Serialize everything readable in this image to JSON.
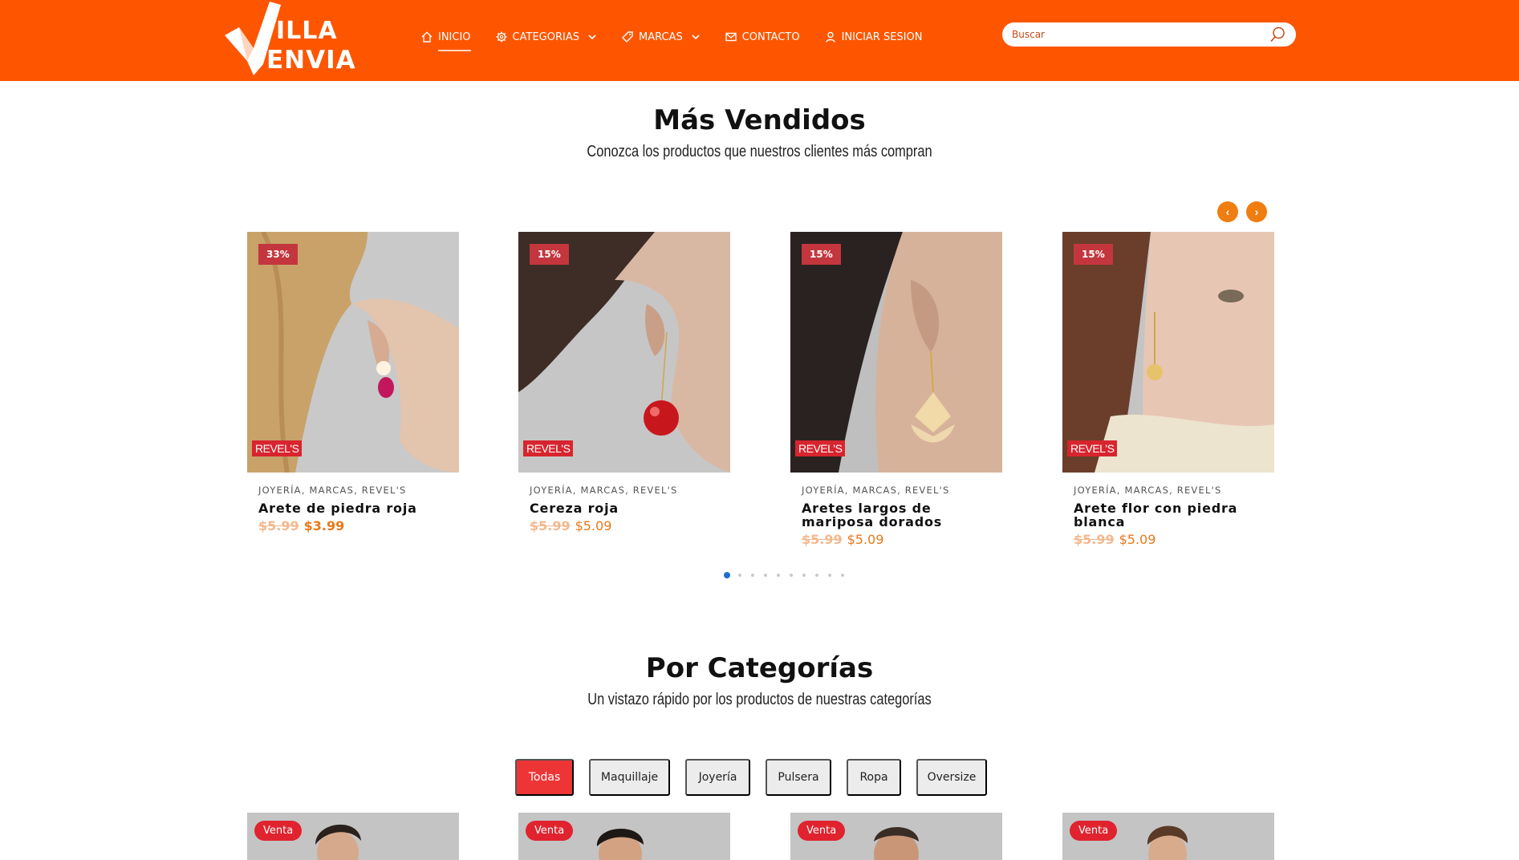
{
  "brand": {
    "line1": "ILLA",
    "line2": "ENVIA",
    "accent": "#fe5600"
  },
  "nav": [
    {
      "label": "INICIO",
      "icon": "home-icon",
      "active": true
    },
    {
      "label": "CATEGORIAS",
      "icon": "gear-icon",
      "dropdown": true
    },
    {
      "label": "MARCAS",
      "icon": "tag-icon",
      "dropdown": true
    },
    {
      "label": "CONTACTO",
      "icon": "mail-icon"
    },
    {
      "label": "INICIAR SESION",
      "icon": "user-icon"
    }
  ],
  "search": {
    "placeholder": "Buscar",
    "value": ""
  },
  "bestsellers": {
    "title": "Más Vendidos",
    "subtitle": "Conozca los productos que nuestros clientes más compran",
    "prev": "‹",
    "next": "›",
    "products": [
      {
        "badge": "33%",
        "brand_tag": "REVEL'S",
        "categories": "Joyería, Marcas, Revel's",
        "name": "Arete de piedra roja",
        "old_price": "$5.99",
        "price": "$3.99"
      },
      {
        "badge": "15%",
        "brand_tag": "REVEL'S",
        "categories": "Joyería, Marcas, Revel's",
        "name": "Cereza roja",
        "old_price": "$5.99",
        "price": "$5.09"
      },
      {
        "badge": "15%",
        "brand_tag": "REVEL'S",
        "categories": "Joyería, Marcas, Revel's",
        "name": "Aretes largos de mariposa dorados",
        "old_price": "$5.99",
        "price": "$5.09"
      },
      {
        "badge": "15%",
        "brand_tag": "REVEL'S",
        "categories": "Joyería, Marcas, Revel's",
        "name": "Arete flor con piedra blanca",
        "old_price": "$5.99",
        "price": "$5.09"
      }
    ]
  },
  "categories": {
    "title": "Por Categorías",
    "subtitle": "Un vistazo rápido por los productos de nuestras categorías",
    "filters": [
      "Todas",
      "Maquillaje",
      "Joyería",
      "Pulsera",
      "Ropa",
      "Oversize"
    ],
    "active_filter": "Todas",
    "cards": [
      {
        "badge": "Venta"
      },
      {
        "badge": "Venta"
      },
      {
        "badge": "Venta"
      },
      {
        "badge": "Venta"
      }
    ]
  }
}
